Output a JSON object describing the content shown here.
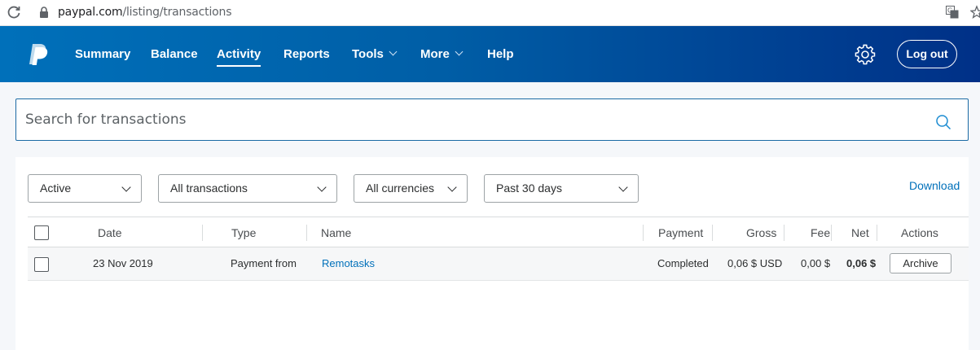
{
  "browser": {
    "url_host": "paypal.com",
    "url_path": "/listing/transactions"
  },
  "nav": {
    "items": [
      {
        "label": "Summary"
      },
      {
        "label": "Balance"
      },
      {
        "label": "Activity",
        "active": true
      },
      {
        "label": "Reports"
      },
      {
        "label": "Tools"
      },
      {
        "label": "More"
      },
      {
        "label": "Help"
      }
    ],
    "logout_label": "Log out"
  },
  "search": {
    "placeholder": "Search for transactions"
  },
  "filters": {
    "status": "Active",
    "type": "All transactions",
    "currency": "All currencies",
    "period": "Past 30 days",
    "download_label": "Download"
  },
  "table": {
    "headers": {
      "date": "Date",
      "type": "Type",
      "name": "Name",
      "payment": "Payment",
      "gross": "Gross",
      "fee": "Fee",
      "net": "Net",
      "actions": "Actions"
    },
    "rows": [
      {
        "date": "23 Nov 2019",
        "type": "Payment from",
        "name": "Remotasks",
        "payment": "Completed",
        "gross": "0,06 $ USD",
        "fee": "0,00 $",
        "net": "0,06 $",
        "action": "Archive"
      }
    ]
  },
  "colors": {
    "brand_blue": "#0070ba",
    "brand_dark": "#003087",
    "link": "#0070ba"
  }
}
